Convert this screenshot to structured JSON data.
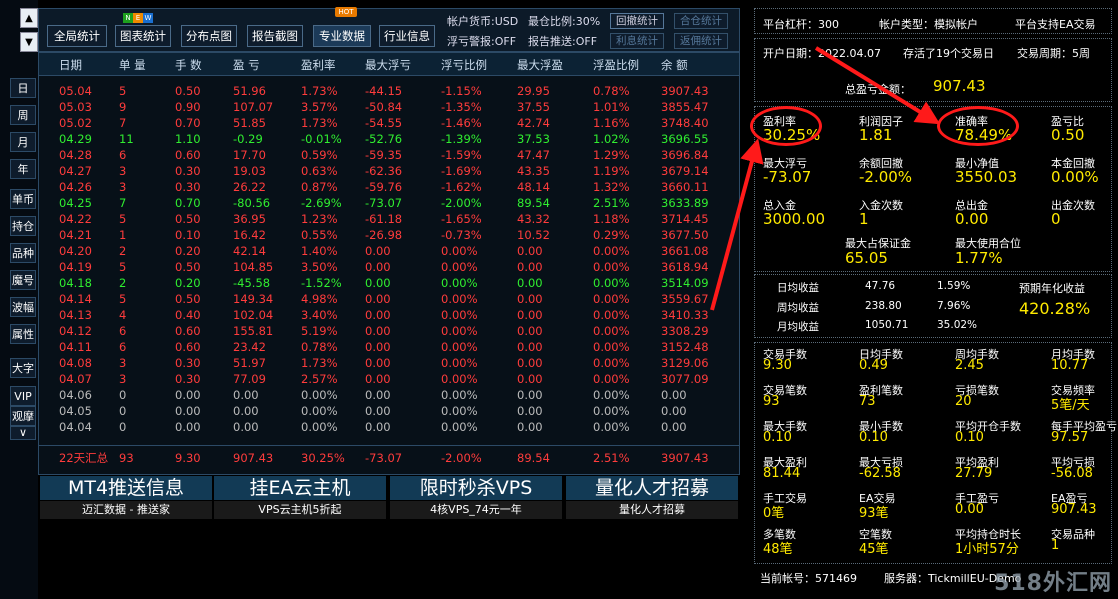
{
  "sidebar": {
    "up_arrow": "▲",
    "down_arrow": "▼",
    "more_arrow": "∨",
    "items": [
      "日",
      "周",
      "月",
      "年",
      "单币",
      "持仓",
      "品种",
      "魔号",
      "波幅",
      "属性",
      "大字",
      "VIP",
      "观摩"
    ]
  },
  "toolbar": {
    "buttons": [
      "全局统计",
      "图表统计",
      "分布点图",
      "报告截图",
      "专业数据",
      "行业信息"
    ],
    "new_badge": "NEW",
    "hot_badge": "HOT",
    "account_currency": "帐户货币:USD",
    "max_position": "最仓比例:30%",
    "float_warning": "浮亏警报:OFF",
    "report_push": "报告推送:OFF",
    "right_buttons": [
      "回撤统计",
      "合仓统计",
      "利息统计",
      "返佣统计"
    ]
  },
  "table": {
    "headers": [
      "日期",
      "单 量",
      "手 数",
      "盈 亏",
      "盈利率",
      "最大浮亏",
      "浮亏比例",
      "最大浮盈",
      "浮盈比例",
      "余 额"
    ],
    "rows": [
      {
        "c": "red",
        "v": [
          "05.04",
          "5",
          "0.50",
          "51.96",
          "1.73%",
          "-44.15",
          "-1.15%",
          "29.95",
          "0.78%",
          "3907.43"
        ]
      },
      {
        "c": "red",
        "v": [
          "05.03",
          "9",
          "0.90",
          "107.07",
          "3.57%",
          "-50.84",
          "-1.35%",
          "37.55",
          "1.01%",
          "3855.47"
        ]
      },
      {
        "c": "red",
        "v": [
          "05.02",
          "7",
          "0.70",
          "51.85",
          "1.73%",
          "-54.55",
          "-1.46%",
          "42.74",
          "1.16%",
          "3748.40"
        ]
      },
      {
        "c": "green",
        "v": [
          "04.29",
          "11",
          "1.10",
          "-0.29",
          "-0.01%",
          "-52.76",
          "-1.39%",
          "37.53",
          "1.02%",
          "3696.55"
        ]
      },
      {
        "c": "red",
        "v": [
          "04.28",
          "6",
          "0.60",
          "17.70",
          "0.59%",
          "-59.35",
          "-1.59%",
          "47.47",
          "1.29%",
          "3696.84"
        ]
      },
      {
        "c": "red",
        "v": [
          "04.27",
          "3",
          "0.30",
          "19.03",
          "0.63%",
          "-62.36",
          "-1.69%",
          "43.35",
          "1.19%",
          "3679.14"
        ]
      },
      {
        "c": "red",
        "v": [
          "04.26",
          "3",
          "0.30",
          "26.22",
          "0.87%",
          "-59.76",
          "-1.62%",
          "48.14",
          "1.32%",
          "3660.11"
        ]
      },
      {
        "c": "green",
        "v": [
          "04.25",
          "7",
          "0.70",
          "-80.56",
          "-2.69%",
          "-73.07",
          "-2.00%",
          "89.54",
          "2.51%",
          "3633.89"
        ]
      },
      {
        "c": "red",
        "v": [
          "04.22",
          "5",
          "0.50",
          "36.95",
          "1.23%",
          "-61.18",
          "-1.65%",
          "43.32",
          "1.18%",
          "3714.45"
        ]
      },
      {
        "c": "red",
        "v": [
          "04.21",
          "1",
          "0.10",
          "16.42",
          "0.55%",
          "-26.98",
          "-0.73%",
          "10.52",
          "0.29%",
          "3677.50"
        ]
      },
      {
        "c": "red",
        "v": [
          "04.20",
          "2",
          "0.20",
          "42.14",
          "1.40%",
          "0.00",
          "0.00%",
          "0.00",
          "0.00%",
          "3661.08"
        ]
      },
      {
        "c": "red",
        "v": [
          "04.19",
          "5",
          "0.50",
          "104.85",
          "3.50%",
          "0.00",
          "0.00%",
          "0.00",
          "0.00%",
          "3618.94"
        ]
      },
      {
        "c": "green",
        "v": [
          "04.18",
          "2",
          "0.20",
          "-45.58",
          "-1.52%",
          "0.00",
          "0.00%",
          "0.00",
          "0.00%",
          "3514.09"
        ]
      },
      {
        "c": "red",
        "v": [
          "04.14",
          "5",
          "0.50",
          "149.34",
          "4.98%",
          "0.00",
          "0.00%",
          "0.00",
          "0.00%",
          "3559.67"
        ]
      },
      {
        "c": "red",
        "v": [
          "04.13",
          "4",
          "0.40",
          "102.04",
          "3.40%",
          "0.00",
          "0.00%",
          "0.00",
          "0.00%",
          "3410.33"
        ]
      },
      {
        "c": "red",
        "v": [
          "04.12",
          "6",
          "0.60",
          "155.81",
          "5.19%",
          "0.00",
          "0.00%",
          "0.00",
          "0.00%",
          "3308.29"
        ]
      },
      {
        "c": "red",
        "v": [
          "04.11",
          "6",
          "0.60",
          "23.42",
          "0.78%",
          "0.00",
          "0.00%",
          "0.00",
          "0.00%",
          "3152.48"
        ]
      },
      {
        "c": "red",
        "v": [
          "04.08",
          "3",
          "0.30",
          "51.97",
          "1.73%",
          "0.00",
          "0.00%",
          "0.00",
          "0.00%",
          "3129.06"
        ]
      },
      {
        "c": "red",
        "v": [
          "04.07",
          "3",
          "0.30",
          "77.09",
          "2.57%",
          "0.00",
          "0.00%",
          "0.00",
          "0.00%",
          "3077.09"
        ]
      },
      {
        "c": "gray",
        "v": [
          "04.06",
          "0",
          "0.00",
          "0.00",
          "0.00%",
          "0.00",
          "0.00%",
          "0.00",
          "0.00%",
          "0.00"
        ]
      },
      {
        "c": "gray",
        "v": [
          "04.05",
          "0",
          "0.00",
          "0.00",
          "0.00%",
          "0.00",
          "0.00%",
          "0.00",
          "0.00%",
          "0.00"
        ]
      },
      {
        "c": "gray",
        "v": [
          "04.04",
          "0",
          "0.00",
          "0.00",
          "0.00%",
          "0.00",
          "0.00%",
          "0.00",
          "0.00%",
          "0.00"
        ]
      }
    ],
    "summary": [
      "22天汇总",
      "93",
      "9.30",
      "907.43",
      "30.25%",
      "-73.07",
      "-2.00%",
      "89.54",
      "2.51%",
      "3907.43"
    ]
  },
  "banners": [
    {
      "title": "MT4推送信息",
      "sub": "迈汇数据 - 推送家"
    },
    {
      "title": "挂EA云主机",
      "sub": "VPS云主机5折起"
    },
    {
      "title": "限时秒杀VPS",
      "sub": "4核VPS_74元一年"
    },
    {
      "title": "量化人才招募",
      "sub": "量化人才招募"
    }
  ],
  "account": {
    "leverage": "平台杠杆：300",
    "account_type": "帐户类型：模拟帐户",
    "ea_support": "平台支持EA交易",
    "open_date": "开户日期：2022.04.07",
    "survival": "存活了19个交易日",
    "period": "交易周期：5周",
    "total_pl_label": "总盈亏金额：",
    "total_pl_value": "907.43"
  },
  "stats": [
    {
      "label": "盈利率",
      "value": "30.25%"
    },
    {
      "label": "利润因子",
      "value": "1.81"
    },
    {
      "label": "准确率",
      "value": "78.49%"
    },
    {
      "label": "盈亏比",
      "value": "0.50"
    },
    {
      "label": "最大浮亏",
      "value": "-73.07"
    },
    {
      "label": "余额回撤",
      "value": "-2.00%"
    },
    {
      "label": "最小净值",
      "value": "3550.03"
    },
    {
      "label": "本金回撤",
      "value": "0.00%"
    },
    {
      "label": "总入金",
      "value": "3000.00"
    },
    {
      "label": "入金次数",
      "value": "1"
    },
    {
      "label": "总出金",
      "value": "0.00"
    },
    {
      "label": "出金次数",
      "value": "0"
    }
  ],
  "margin": [
    {
      "label": "最大占保证金",
      "value": "65.05"
    },
    {
      "label": "最大使用合位",
      "value": "1.77%"
    }
  ],
  "avg_profit": {
    "rows": [
      {
        "label": "日均收益",
        "amount": "47.76",
        "pct": "1.59%"
      },
      {
        "label": "周均收益",
        "amount": "238.80",
        "pct": "7.96%"
      },
      {
        "label": "月均收益",
        "amount": "1050.71",
        "pct": "35.02%"
      }
    ],
    "annual_label": "预期年化收益",
    "annual_value": "420.28%"
  },
  "trade_stats": [
    {
      "label": "交易手数",
      "value": "9.30"
    },
    {
      "label": "日均手数",
      "value": "0.49"
    },
    {
      "label": "周均手数",
      "value": "2.45"
    },
    {
      "label": "月均手数",
      "value": "10.77"
    },
    {
      "label": "交易笔数",
      "value": "93"
    },
    {
      "label": "盈利笔数",
      "value": "73"
    },
    {
      "label": "亏损笔数",
      "value": "20"
    },
    {
      "label": "交易频率",
      "value": "5笔/天"
    },
    {
      "label": "最大手数",
      "value": "0.10"
    },
    {
      "label": "最小手数",
      "value": "0.10"
    },
    {
      "label": "平均开仓手数",
      "value": "0.10"
    },
    {
      "label": "每手平均盈亏",
      "value": "97.57"
    },
    {
      "label": "最大盈利",
      "value": "81.44"
    },
    {
      "label": "最大亏损",
      "value": "-62.58"
    },
    {
      "label": "平均盈利",
      "value": "27.79"
    },
    {
      "label": "平均亏损",
      "value": "-56.08"
    },
    {
      "label": "手工交易",
      "value": "0笔"
    },
    {
      "label": "EA交易",
      "value": "93笔"
    },
    {
      "label": "手工盈亏",
      "value": "0.00"
    },
    {
      "label": "EA盈亏",
      "value": "907.43"
    },
    {
      "label": "多笔数",
      "value": "48笔"
    },
    {
      "label": "空笔数",
      "value": "45笔"
    },
    {
      "label": "平均持仓时长",
      "value": "1小时57分"
    },
    {
      "label": "交易品种",
      "value": "1"
    }
  ],
  "footer": {
    "account_no": "当前帐号：571469",
    "server": "服务器：TickmillEU-Demo"
  },
  "watermark": "518外汇网",
  "colors": {
    "red": "#ff3c3c",
    "green": "#30ee30",
    "yellow": "#ffea00",
    "accent": "#123a55"
  }
}
